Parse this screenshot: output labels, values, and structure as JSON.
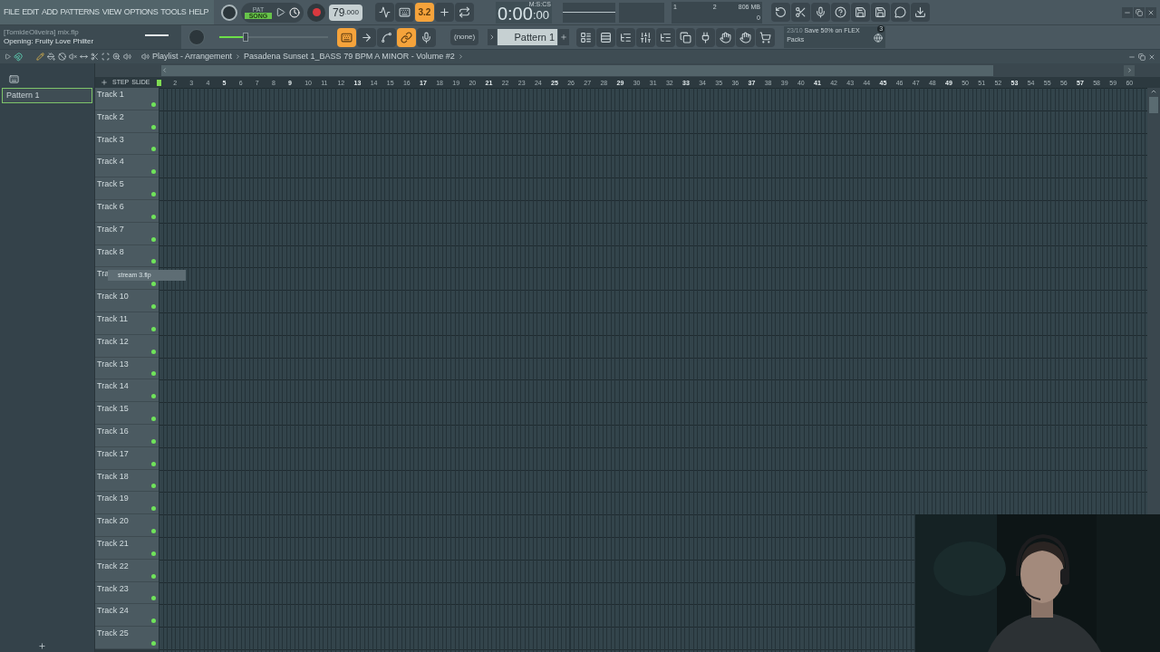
{
  "menu": [
    "FILE",
    "EDIT",
    "ADD",
    "PATTERNS",
    "VIEW",
    "OPTIONS",
    "TOOLS",
    "HELP"
  ],
  "hint": {
    "title": "[TomideOliveira] mix.flp",
    "message": "Opening: Fruity Love Philter"
  },
  "transport": {
    "modes": [
      {
        "label": "PAT",
        "selected": false
      },
      {
        "label": "SONG",
        "selected": true
      }
    ],
    "recording": false
  },
  "tempo": {
    "whole": "79",
    "fraction": ".000"
  },
  "toolbar_top": [
    {
      "on": false
    },
    {
      "on": false
    },
    {
      "on": true,
      "label": "3.2"
    },
    {
      "on": false
    },
    {
      "on": false
    }
  ],
  "time": {
    "main": "0:00",
    "small": ":00",
    "unit": "M:S:CS"
  },
  "monitor": {
    "cpu": "1",
    "voices": "2",
    "memory": "806 MB",
    "polyphony": "0"
  },
  "toolbar_bottom": [
    {
      "on": true
    },
    {
      "on": false
    },
    {
      "on": false
    },
    {
      "on": true
    },
    {
      "on": false
    }
  ],
  "master_volume": {
    "level": 0.24
  },
  "channel_filter": "(none)",
  "pattern": "Pattern 1",
  "news": {
    "date": "23/10",
    "text": "Save 50% on FLEX Packs",
    "badge": "3"
  },
  "playlist": {
    "title": "Playlist - Arrangement",
    "project": "Pasadena Sunset 1_BASS 79 BPM A MINOR - Volume #2",
    "step_label": "STEP",
    "slide_label": "SLIDE",
    "patterns": [
      {
        "name": "Pattern 1",
        "selected": true
      }
    ],
    "ruler": [
      {
        "n": "2",
        "major": false
      },
      {
        "n": "3",
        "major": false
      },
      {
        "n": "4",
        "major": false
      },
      {
        "n": "5",
        "major": true
      },
      {
        "n": "6",
        "major": false
      },
      {
        "n": "7",
        "major": false
      },
      {
        "n": "8",
        "major": false
      },
      {
        "n": "9",
        "major": true
      },
      {
        "n": "10",
        "major": false
      },
      {
        "n": "11",
        "major": false
      },
      {
        "n": "12",
        "major": false
      },
      {
        "n": "13",
        "major": true
      },
      {
        "n": "14",
        "major": false
      },
      {
        "n": "15",
        "major": false
      },
      {
        "n": "16",
        "major": false
      },
      {
        "n": "17",
        "major": true
      },
      {
        "n": "18",
        "major": false
      },
      {
        "n": "19",
        "major": false
      },
      {
        "n": "20",
        "major": false
      },
      {
        "n": "21",
        "major": true
      },
      {
        "n": "22",
        "major": false
      },
      {
        "n": "23",
        "major": false
      },
      {
        "n": "24",
        "major": false
      },
      {
        "n": "25",
        "major": true
      },
      {
        "n": "26",
        "major": false
      },
      {
        "n": "27",
        "major": false
      },
      {
        "n": "28",
        "major": false
      },
      {
        "n": "29",
        "major": true
      },
      {
        "n": "30",
        "major": false
      },
      {
        "n": "31",
        "major": false
      },
      {
        "n": "32",
        "major": false
      },
      {
        "n": "33",
        "major": true
      },
      {
        "n": "34",
        "major": false
      },
      {
        "n": "35",
        "major": false
      },
      {
        "n": "36",
        "major": false
      },
      {
        "n": "37",
        "major": true
      },
      {
        "n": "38",
        "major": false
      },
      {
        "n": "39",
        "major": false
      },
      {
        "n": "40",
        "major": false
      },
      {
        "n": "41",
        "major": true
      },
      {
        "n": "42",
        "major": false
      },
      {
        "n": "43",
        "major": false
      },
      {
        "n": "44",
        "major": false
      },
      {
        "n": "45",
        "major": true
      },
      {
        "n": "46",
        "major": false
      },
      {
        "n": "47",
        "major": false
      },
      {
        "n": "48",
        "major": false
      },
      {
        "n": "49",
        "major": true
      },
      {
        "n": "50",
        "major": false
      },
      {
        "n": "51",
        "major": false
      },
      {
        "n": "52",
        "major": false
      },
      {
        "n": "53",
        "major": true
      },
      {
        "n": "54",
        "major": false
      },
      {
        "n": "55",
        "major": false
      },
      {
        "n": "56",
        "major": false
      },
      {
        "n": "57",
        "major": true
      },
      {
        "n": "58",
        "major": false
      },
      {
        "n": "59",
        "major": false
      },
      {
        "n": "60",
        "major": false
      }
    ],
    "tracks": [
      {
        "name": "Track 1"
      },
      {
        "name": "Track 2"
      },
      {
        "name": "Track 3"
      },
      {
        "name": "Track 4"
      },
      {
        "name": "Track 5"
      },
      {
        "name": "Track 6"
      },
      {
        "name": "Track 7"
      },
      {
        "name": "Track 8"
      },
      {
        "name": "Tra"
      },
      {
        "name": "Track 10"
      },
      {
        "name": "Track 11"
      },
      {
        "name": "Track 12"
      },
      {
        "name": "Track 13"
      },
      {
        "name": "Track 14"
      },
      {
        "name": "Track 15"
      },
      {
        "name": "Track 16"
      },
      {
        "name": "Track 17"
      },
      {
        "name": "Track 18"
      },
      {
        "name": "Track 19"
      },
      {
        "name": "Track 20"
      },
      {
        "name": "Track 21"
      },
      {
        "name": "Track 22"
      },
      {
        "name": "Track 23"
      },
      {
        "name": "Track 24"
      },
      {
        "name": "Track 25"
      }
    ],
    "tooltip": "stream 3.flp"
  }
}
